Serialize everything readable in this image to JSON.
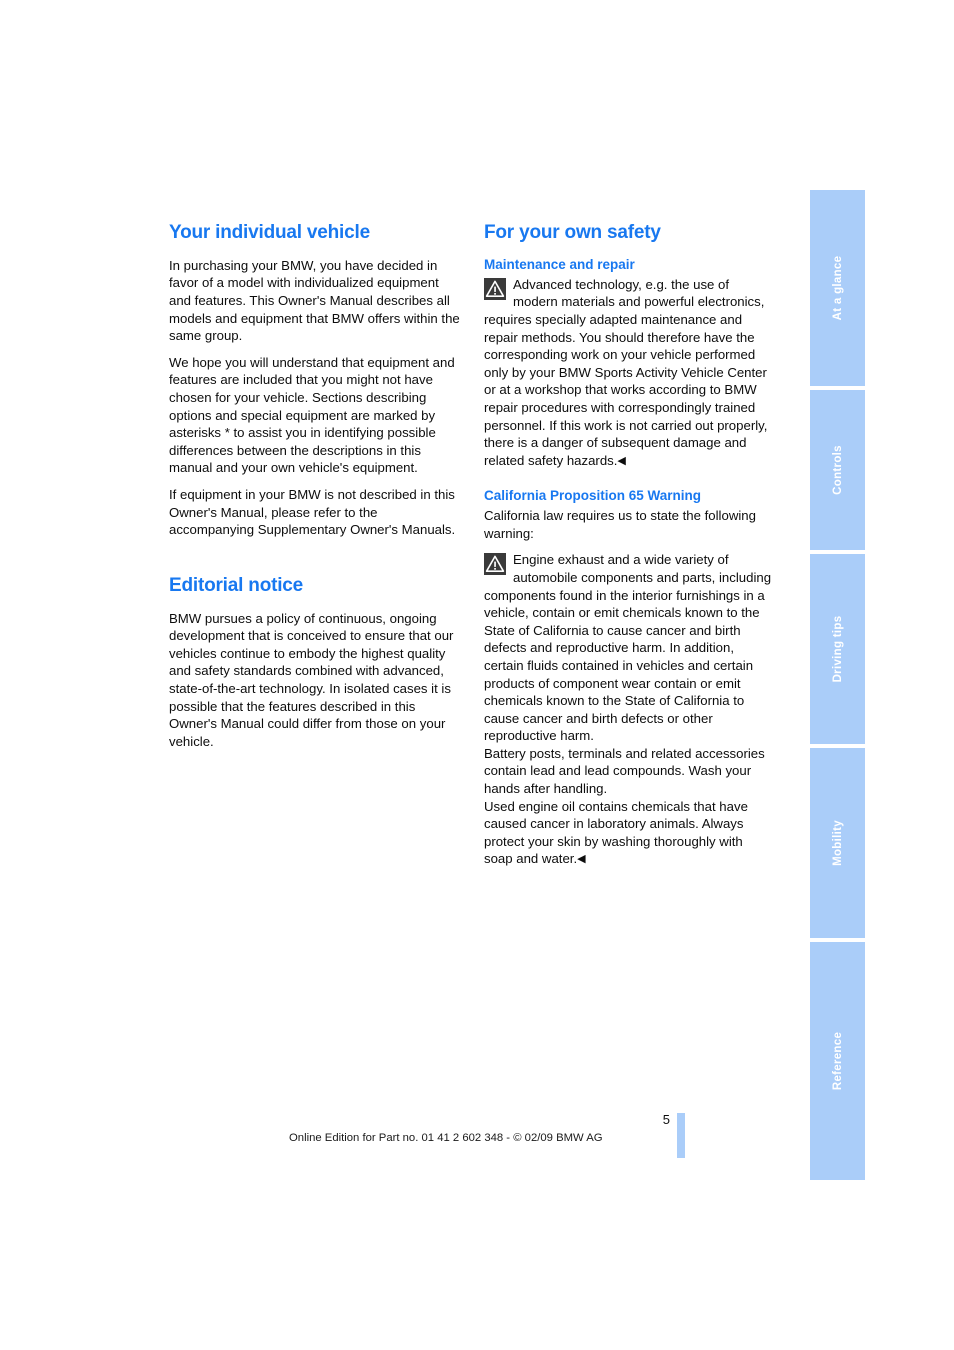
{
  "colors": {
    "heading_blue": "#1878f0",
    "tab_blue": "#aacdf9",
    "body_black": "#0d0d0d",
    "icon_dark": "#3a3a3a"
  },
  "left_column": {
    "section_1": {
      "title": "Your individual vehicle",
      "paragraphs": [
        "In purchasing your BMW, you have decided in favor of a model with individualized equipment and features. This Owner's Manual describes all models and equipment that BMW offers within the same group.",
        "We hope you will understand that equipment and features are included that you might not have chosen for your vehicle. Sections describing options and special equipment are marked by asterisks * to assist you in identifying possible differences between the descriptions in this manual and your own vehicle's equipment.",
        "If equipment in your BMW is not described in this Owner's Manual, please refer to the accompanying Supplementary Owner's Manuals."
      ]
    },
    "section_2": {
      "title": "Editorial notice",
      "paragraphs": [
        "BMW pursues a policy of continuous, ongoing development that is conceived to ensure that our vehicles continue to embody the highest quality and safety standards combined with advanced, state-of-the-art technology. In isolated cases it is possible that the features described in this Owner's Manual could differ from those on your vehicle."
      ]
    }
  },
  "right_column": {
    "section_title": "For your own safety",
    "subsection_1": {
      "title": "Maintenance and repair",
      "warning_icon": "warning-triangle-icon",
      "warning_text": "Advanced technology, e.g. the use of modern materials and powerful electronics, requires specially adapted maintenance and repair methods. You should therefore have the corresponding work on your vehicle performed only by your BMW Sports Activity Vehicle Center or at a workshop that works according to BMW repair procedures with correspondingly trained personnel. If this work is not carried out properly, there is a danger of subsequent damage and related safety hazards.",
      "end_marker": "◀"
    },
    "subsection_2": {
      "title": "California Proposition 65 Warning",
      "intro": "California law requires us to state the following warning:",
      "warning_icon": "warning-triangle-icon",
      "warning_text": "Engine exhaust and a wide variety of automobile components and parts, including components found in the interior furnishings in a vehicle, contain or emit chemicals known to the State of California to cause cancer and birth defects and reproductive harm. In addition, certain fluids contained in vehicles and certain products of component wear contain or emit chemicals known to the State of California to cause cancer and birth defects or other reproductive harm.",
      "paragraph_2": "Battery posts, terminals and related accessories contain lead and lead compounds. Wash your hands after handling.",
      "paragraph_3": "Used engine oil contains chemicals that have caused cancer in laboratory animals. Always protect your skin by washing thoroughly with soap and water.",
      "end_marker": "◀"
    }
  },
  "tabs": [
    {
      "label": "At a glance"
    },
    {
      "label": "Controls"
    },
    {
      "label": "Driving tips"
    },
    {
      "label": "Mobility"
    },
    {
      "label": "Reference"
    }
  ],
  "footer": {
    "note": "Online Edition for Part no. 01 41 2 602 348 - © 02/09 BMW AG",
    "page_number": "5"
  }
}
